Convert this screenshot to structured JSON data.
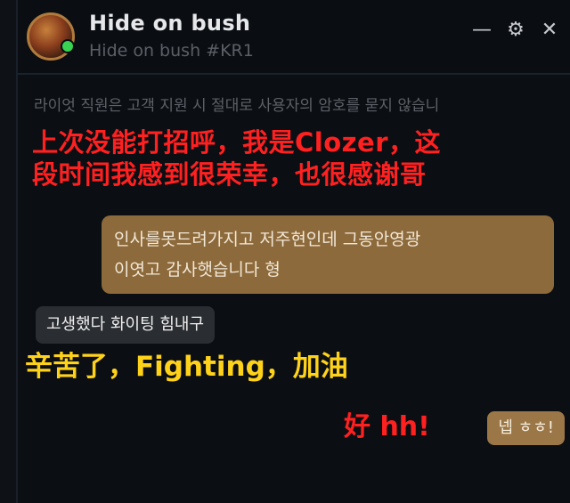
{
  "window": {
    "title_name": "Hide on bush",
    "title_tag": "Hide on bush #KR1",
    "minimize_glyph": "—",
    "settings_glyph": "⚙",
    "close_glyph": "✕"
  },
  "chat": {
    "notice": "라이엇 직원은 고객 지원 시 절대로 사용자의 암호를 묻지 않습니",
    "incoming_message": "인사를못드려가지고 저주현인데 그동안영광\n이엿고 감사햇습니다 형",
    "outgoing_message": "고생했다 화이팅 힘내구",
    "reply_message": "넵 ㅎㅎ!"
  },
  "captions": {
    "red_top": "上次没能打招呼，我是Clozer，这\n段时间我感到很荣幸，也很感谢哥",
    "yellow_middle": "辛苦了，Fighting，加油",
    "red_bottom": "好 hh!"
  },
  "colors": {
    "background": "#0b0e13",
    "incoming_bubble": "#8d6a3b",
    "outgoing_bubble": "#2a2d31",
    "reply_bubble": "#9b7747",
    "caption_red": "#ff2020",
    "caption_yellow": "#ffd21a",
    "status_online": "#39d353"
  },
  "icons": {
    "avatar": "profile-avatar",
    "status": "online-status-icon",
    "minimize": "minimize-icon",
    "settings": "gear-icon",
    "close": "close-icon"
  }
}
